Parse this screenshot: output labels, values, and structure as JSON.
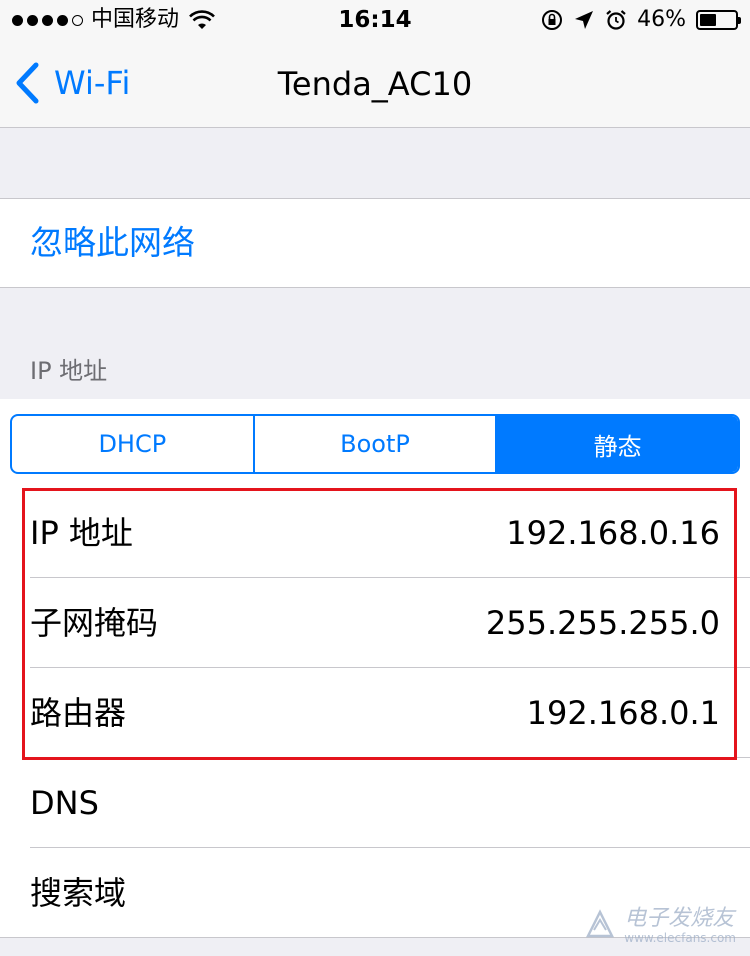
{
  "status_bar": {
    "carrier": "中国移动",
    "time": "16:14",
    "battery_percent": "46%",
    "battery_level": 0.46,
    "icons": [
      "signal-dots-icon",
      "wifi-icon",
      "orientation-lock-icon",
      "location-icon",
      "alarm-icon",
      "battery-icon"
    ]
  },
  "nav": {
    "back_label": "Wi-Fi",
    "title": "Tenda_AC10"
  },
  "forget_network": "忽略此网络",
  "ip_section_header": "IP 地址",
  "segments": [
    {
      "label": "DHCP",
      "selected": false
    },
    {
      "label": "BootP",
      "selected": false
    },
    {
      "label": "静态",
      "selected": true
    }
  ],
  "rows": [
    {
      "label": "IP 地址",
      "value": "192.168.0.16"
    },
    {
      "label": "子网掩码",
      "value": "255.255.255.0"
    },
    {
      "label": "路由器",
      "value": "192.168.0.1"
    },
    {
      "label": "DNS",
      "value": ""
    },
    {
      "label": "搜索域",
      "value": ""
    }
  ],
  "watermark": {
    "title": "电子发烧友",
    "url": "www.elecfans.com"
  },
  "colors": {
    "accent": "#007aff",
    "highlight": "#e4141c",
    "background": "#efeff4"
  }
}
